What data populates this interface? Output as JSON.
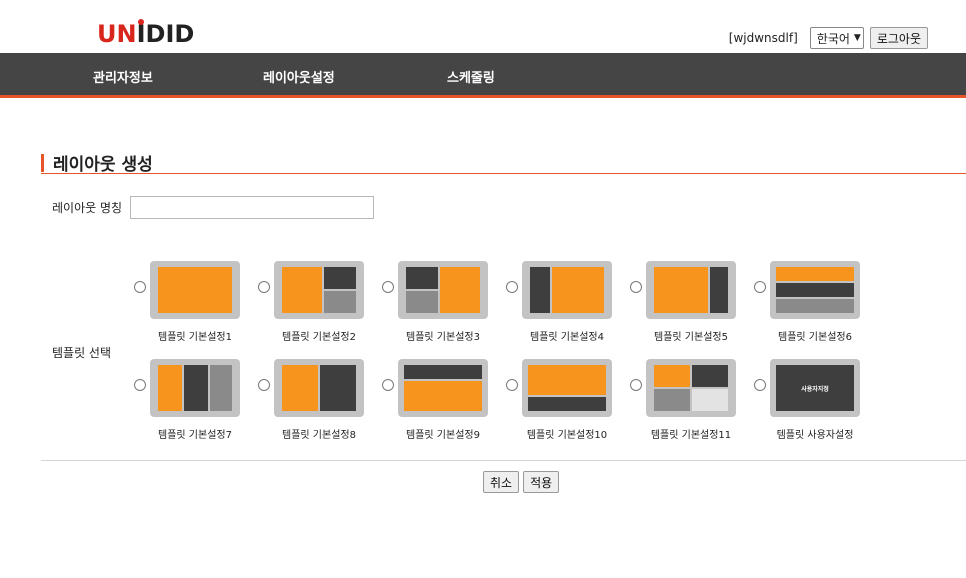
{
  "header": {
    "logo": "UNIDID",
    "username": "[wjdwnsdlf]",
    "language": "한국어",
    "logout_label": "로그아웃"
  },
  "nav": {
    "items": [
      {
        "label": "관리자정보"
      },
      {
        "label": "레이아웃설정"
      },
      {
        "label": "스케줄링"
      }
    ]
  },
  "page": {
    "title": "레이아웃 생성",
    "name_label": "레이아웃 명칭",
    "name_value": "",
    "template_label": "템플릿 선택"
  },
  "templates": [
    {
      "caption": "템플릿 기본설정1",
      "selected": false
    },
    {
      "caption": "템플릿 기본설정2",
      "selected": false
    },
    {
      "caption": "템플릿 기본설정3",
      "selected": false
    },
    {
      "caption": "템플릿 기본설정4",
      "selected": false
    },
    {
      "caption": "템플릿 기본설정5",
      "selected": false
    },
    {
      "caption": "템플릿 기본설정6",
      "selected": false
    },
    {
      "caption": "템플릿 기본설정7",
      "selected": false
    },
    {
      "caption": "템플릿 기본설정8",
      "selected": false
    },
    {
      "caption": "템플릿 기본설정9",
      "selected": false
    },
    {
      "caption": "템플릿 기본설정10",
      "selected": false
    },
    {
      "caption": "템플릿 기본설정11",
      "selected": false
    },
    {
      "caption": "템플릿 사용자설정",
      "selected": false,
      "thumb_text": "사용자지정"
    }
  ],
  "actions": {
    "cancel_label": "취소",
    "apply_label": "적용"
  },
  "colors": {
    "accent": "#e8542a",
    "nav_bg": "#454545",
    "layout_orange": "#f7941d",
    "layout_dark": "#3e3e3e",
    "layout_gray": "#8a8a8a"
  }
}
